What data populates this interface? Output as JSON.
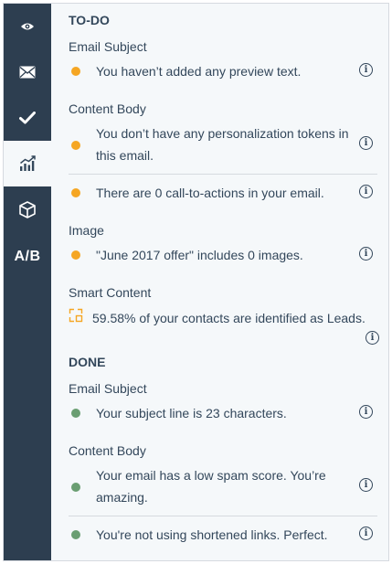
{
  "sidebar": {
    "items": [
      {
        "name": "preview",
        "icon": "eye-icon"
      },
      {
        "name": "email",
        "icon": "envelope-icon"
      },
      {
        "name": "checklist",
        "icon": "checkmark-icon"
      },
      {
        "name": "analytics",
        "icon": "chart-icon",
        "active": true
      },
      {
        "name": "package",
        "icon": "cube-icon"
      },
      {
        "name": "ab-test",
        "label": "A/B"
      }
    ]
  },
  "todo": {
    "heading": "TO-DO",
    "email_subject": {
      "label": "Email Subject",
      "items": [
        {
          "text": "You haven’t added any preview text.",
          "status": "orange"
        }
      ]
    },
    "content_body": {
      "label": "Content Body",
      "items": [
        {
          "text": "You don’t have any personalization tokens in this email.",
          "status": "orange"
        },
        {
          "text": "There are 0 call-to-actions in your email.",
          "status": "orange"
        }
      ]
    },
    "image": {
      "label": "Image",
      "items": [
        {
          "text": "\"June 2017 offer\" includes 0 images.",
          "status": "orange"
        }
      ]
    },
    "smart_content": {
      "label": "Smart Content",
      "items": [
        {
          "text": "59.58% of your contacts are identified as Leads.",
          "icon": "smart-content-icon"
        }
      ]
    }
  },
  "done": {
    "heading": "DONE",
    "email_subject": {
      "label": "Email Subject",
      "items": [
        {
          "text": "Your subject line is 23 characters.",
          "status": "green"
        }
      ]
    },
    "content_body": {
      "label": "Content Body",
      "items": [
        {
          "text": "Your email has a low spam score. You’re amazing.",
          "status": "green"
        },
        {
          "text": "You're not using shortened links. Perfect.",
          "status": "green"
        }
      ]
    }
  },
  "info_glyph": "i",
  "colors": {
    "sidebar": "#2d3e50",
    "panel": "#f5f8fa",
    "warning": "#f5a623",
    "success": "#6a9e72",
    "text": "#33475b"
  }
}
